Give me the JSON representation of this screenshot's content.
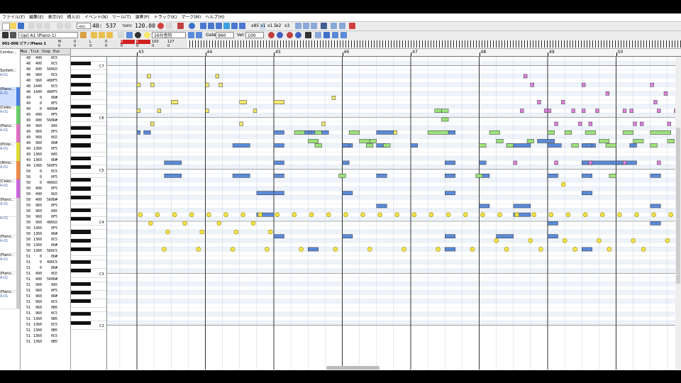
{
  "menu": [
    "ファイル(F)",
    "編集(E)",
    "表示(V)",
    "挿入(I)",
    "イベント(N)",
    "ツール(T)",
    "演奏(P)",
    "トラック(K)",
    "マーク(M)",
    "ヘルプ(H)"
  ],
  "toolbar": {
    "position": "40: 537",
    "tempo": "120.00",
    "track_select": "(gs) A1 (Piano 1)",
    "snap": "16分音符",
    "gate_label": "Gate:",
    "gate_value": "960",
    "vel_label": "Vel:",
    "vel_value": "100",
    "zoom_x85": "x85",
    "zoom_x1": "x1",
    "zoom_x15": "x1.5",
    "zoom_x2": "x2",
    "zoom_x3": "x3"
  },
  "track_header": "001-008 ピアノ/Piano 1",
  "meter_values": [
    "0",
    "0",
    "0",
    "0",
    "0",
    "0",
    "0",
    "0"
  ],
  "meter_labels": [
    "M",
    "0",
    "L",
    "0",
    "R",
    "1",
    "100",
    "127"
  ],
  "tracks": [
    {
      "name": "Conduc...",
      "sub": "",
      "color": "#ffffff"
    },
    {
      "name": "System...",
      "sub": "A-01",
      "color": "#ffffff"
    },
    {
      "name": "(Piano...",
      "sub": "A-01",
      "color": "#4a7fe0"
    },
    {
      "name": "(Celes...",
      "sub": "A-01",
      "color": "#66cc66"
    },
    {
      "name": "(Piano...",
      "sub": "A-01",
      "color": "#e070c0"
    },
    {
      "name": "(Picke...",
      "sub": "A-01",
      "color": "#dddd33"
    },
    {
      "name": "(Atmo...",
      "sub": "A-01",
      "color": "#ee8844"
    },
    {
      "name": "(Celes...",
      "sub": "A-01",
      "color": "#cc66dd"
    },
    {
      "name": "(Piano...",
      "sub": "A-01",
      "color": "#cccccc"
    },
    {
      "name": "",
      "sub": "A-01",
      "color": "#cccccc"
    },
    {
      "name": "(Piano...",
      "sub": "A-01",
      "color": "#cccccc"
    },
    {
      "name": "(Piano...",
      "sub": "A-01",
      "color": "#cccccc"
    },
    {
      "name": "(Piano...",
      "sub": "A-01",
      "color": "#cccccc"
    },
    {
      "name": "(Piano...",
      "sub": "A-01",
      "color": "#cccccc"
    }
  ],
  "event_headers": [
    "Mea",
    "Tick",
    "Step",
    "Eve"
  ],
  "events": [
    [
      "48",
      "400",
      "0",
      "C5"
    ],
    [
      "48",
      "400",
      "0",
      "C5"
    ],
    [
      "48",
      "400",
      "560",
      "G5"
    ],
    [
      "48",
      "960",
      "0",
      "C5"
    ],
    [
      "48",
      "960",
      "480",
      "F5"
    ],
    [
      "48",
      "1440",
      "0",
      "C5"
    ],
    [
      "48",
      "1440",
      "480",
      "F5"
    ],
    [
      "49",
      "0",
      "0",
      "D#"
    ],
    [
      "49",
      "0",
      "0",
      "F5"
    ],
    [
      "49",
      "0",
      "480",
      "D#"
    ],
    [
      "49",
      "400",
      "0",
      "F5"
    ],
    [
      "49",
      "400",
      "560",
      "D#"
    ],
    [
      "49",
      "960",
      "0",
      "A5"
    ],
    [
      "49",
      "960",
      "0",
      "F5"
    ],
    [
      "49",
      "960",
      "0",
      "G5"
    ],
    [
      "49",
      "960",
      "0",
      "D#"
    ],
    [
      "49",
      "1360",
      "0",
      "F5"
    ],
    [
      "49",
      "1360",
      "0",
      "A5"
    ],
    [
      "49",
      "1360",
      "0",
      "D#"
    ],
    [
      "49",
      "1360",
      "560",
      "F5"
    ],
    [
      "50",
      "0",
      "0",
      "C5"
    ],
    [
      "50",
      "0",
      "0",
      "F5"
    ],
    [
      "50",
      "0",
      "400",
      "G5"
    ],
    [
      "50",
      "400",
      "0",
      "F5"
    ],
    [
      "50",
      "400",
      "0",
      "G5"
    ],
    [
      "50",
      "400",
      "560",
      "D#"
    ],
    [
      "50",
      "960",
      "0",
      "F5"
    ],
    [
      "50",
      "960",
      "0",
      "A5"
    ],
    [
      "50",
      "960",
      "0",
      "F5"
    ],
    [
      "50",
      "960",
      "480",
      "G5"
    ],
    [
      "50",
      "1360",
      "0",
      "F5"
    ],
    [
      "50",
      "1360",
      "0",
      "D#"
    ],
    [
      "50",
      "1360",
      "0",
      "C5"
    ],
    [
      "50",
      "1360",
      "0",
      "D#"
    ],
    [
      "50",
      "1360",
      "560",
      "C5"
    ],
    [
      "51",
      "0",
      "0",
      "D#"
    ],
    [
      "51",
      "0",
      "400",
      "C5"
    ],
    [
      "51",
      "0",
      "0",
      "D#"
    ],
    [
      "51",
      "400",
      "0",
      "G5"
    ],
    [
      "51",
      "400",
      "560",
      "D#"
    ],
    [
      "51",
      "960",
      "0",
      "A5"
    ],
    [
      "51",
      "960",
      "0",
      "F5"
    ],
    [
      "51",
      "960",
      "0",
      "D#"
    ],
    [
      "51",
      "960",
      "0",
      "C5"
    ],
    [
      "51",
      "960",
      "0",
      "B5"
    ],
    [
      "51",
      "960",
      "0",
      "C5"
    ],
    [
      "51",
      "1360",
      "0",
      "B5"
    ],
    [
      "51",
      "1360",
      "0",
      "C5"
    ],
    [
      "51",
      "1360",
      "0",
      "B5"
    ],
    [
      "51",
      "1360",
      "0",
      "C5"
    ],
    [
      "51",
      "1360",
      "0",
      "B5"
    ]
  ],
  "bars": [
    "43",
    "44",
    "45",
    "46",
    "47",
    "48",
    "49",
    "50"
  ],
  "octaves": [
    "C7",
    "C6",
    "C5",
    "C4",
    "C3",
    "C2"
  ],
  "colors": {
    "blue_note": "#5b8ad8",
    "green_note": "#9ee27a",
    "pink_note": "#e282de",
    "yellow_note": "#f5ea6a",
    "yellow_dot": "#f2e34a",
    "grid_line": "#dbe3ee",
    "bar_line": "#333333"
  },
  "notes": {
    "blue": [
      [
        49.5,
        0.8,
        38
      ],
      [
        43.1,
        0.1,
        45
      ],
      [
        43.4,
        0.25,
        35
      ],
      [
        44.75,
        0.25,
        26
      ],
      [
        45.35,
        0.25,
        45
      ],
      [
        45.0,
        0.15,
        45
      ],
      [
        45.5,
        0.05,
        45
      ],
      [
        45.7,
        0.1,
        45
      ],
      [
        46.5,
        0.25,
        45
      ],
      [
        47.5,
        0.15,
        45
      ],
      [
        46.0,
        0.15,
        42
      ],
      [
        47.0,
        0.1,
        42
      ],
      [
        48.4,
        0.1,
        42
      ],
      [
        48.85,
        0.25,
        43
      ],
      [
        49.55,
        0.15,
        42
      ],
      [
        50.2,
        0.1,
        42
      ],
      [
        43.0,
        0.05,
        45
      ],
      [
        44.4,
        0.25,
        42
      ],
      [
        45.0,
        0.15,
        42
      ],
      [
        46.0,
        0.1,
        42
      ],
      [
        46.5,
        0.15,
        42
      ],
      [
        48.5,
        0.25,
        42
      ],
      [
        49.0,
        0.2,
        42
      ],
      [
        49.5,
        0.15,
        42
      ],
      [
        45.0,
        0.15,
        38
      ],
      [
        46.0,
        0.1,
        38
      ],
      [
        47.5,
        0.15,
        38
      ],
      [
        48.0,
        0.1,
        38
      ],
      [
        49.5,
        0.15,
        38
      ],
      [
        50.0,
        0.1,
        38
      ],
      [
        43.4,
        0.25,
        38
      ],
      [
        44.4,
        0.25,
        35
      ],
      [
        45.0,
        0.15,
        35
      ],
      [
        46.5,
        0.15,
        35
      ],
      [
        47.5,
        0.15,
        35
      ],
      [
        48.0,
        0.15,
        35
      ],
      [
        49.0,
        0.15,
        35
      ],
      [
        49.5,
        0.15,
        35
      ],
      [
        50.5,
        0.15,
        35
      ],
      [
        44.75,
        0.25,
        31
      ],
      [
        45.0,
        0.15,
        31
      ],
      [
        46.0,
        0.15,
        31
      ],
      [
        46.5,
        0.15,
        28
      ],
      [
        47.5,
        0.15,
        31
      ],
      [
        48.0,
        0.15,
        28
      ],
      [
        48.5,
        0.25,
        28
      ],
      [
        49.5,
        0.15,
        31
      ],
      [
        50.5,
        0.15,
        28
      ],
      [
        49.0,
        0.15,
        24
      ],
      [
        50.5,
        0.15,
        24
      ],
      [
        45.0,
        0.15,
        21
      ],
      [
        46.0,
        0.15,
        21
      ],
      [
        47.5,
        0.15,
        21
      ],
      [
        48.25,
        0.25,
        21
      ],
      [
        49.0,
        0.15,
        21
      ],
      [
        45.5,
        0.15,
        18
      ],
      [
        47.5,
        0.15,
        18
      ],
      [
        49.5,
        0.15,
        18
      ],
      [
        48.5,
        0.25,
        26
      ]
    ],
    "green": [
      [
        45.3,
        0.15,
        45
      ],
      [
        45.6,
        0.1,
        45
      ],
      [
        46.1,
        0.15,
        45
      ],
      [
        47.25,
        0.3,
        45
      ],
      [
        48.15,
        0.15,
        45
      ],
      [
        49.0,
        0.1,
        45
      ],
      [
        49.25,
        0.1,
        45
      ],
      [
        49.55,
        0.15,
        45
      ],
      [
        50.1,
        0.15,
        45
      ],
      [
        50.5,
        0.3,
        45
      ],
      [
        45.5,
        0.15,
        43
      ],
      [
        46.25,
        0.15,
        43
      ],
      [
        46.4,
        0.1,
        43
      ],
      [
        48.25,
        0.1,
        43
      ],
      [
        49.75,
        0.15,
        43
      ],
      [
        50.25,
        0.15,
        43
      ],
      [
        50.75,
        0.1,
        43
      ],
      [
        45.6,
        0.1,
        42
      ],
      [
        46.35,
        0.1,
        42
      ],
      [
        48.4,
        0.1,
        42
      ],
      [
        49.35,
        0.1,
        42
      ],
      [
        50.5,
        0.1,
        42
      ],
      [
        45.95,
        0.1,
        35
      ],
      [
        47.95,
        0.1,
        35
      ],
      [
        49.9,
        0.1,
        35
      ],
      [
        47.35,
        0.1,
        50
      ],
      [
        47.45,
        0.1,
        50
      ],
      [
        47.45,
        0.1,
        48
      ],
      [
        48.7,
        0.1,
        43
      ],
      [
        46.6,
        0.1,
        42
      ],
      [
        48.0,
        0.1,
        42
      ],
      [
        49.85,
        0.15,
        42
      ]
    ],
    "pink": [
      [
        48.65,
        0.05,
        58
      ],
      [
        48.75,
        0.05,
        56
      ],
      [
        49.5,
        0.05,
        56
      ],
      [
        50.5,
        0.05,
        56
      ],
      [
        49.85,
        0.05,
        54
      ],
      [
        50.7,
        0.05,
        54
      ],
      [
        48.85,
        0.05,
        52
      ],
      [
        49.2,
        0.05,
        52
      ],
      [
        50.55,
        0.05,
        52
      ],
      [
        49.0,
        0.05,
        50
      ],
      [
        49.5,
        0.05,
        50
      ],
      [
        50.1,
        0.05,
        50
      ],
      [
        48.6,
        0.05,
        50
      ],
      [
        48.95,
        0.05,
        50
      ],
      [
        49.35,
        0.05,
        50
      ],
      [
        49.7,
        0.05,
        50
      ],
      [
        50.2,
        0.05,
        50
      ],
      [
        50.6,
        0.05,
        50
      ],
      [
        50.85,
        0.05,
        50
      ],
      [
        49.1,
        0.05,
        47
      ],
      [
        49.45,
        0.05,
        47
      ],
      [
        49.6,
        0.05,
        47
      ],
      [
        50.25,
        0.05,
        47
      ],
      [
        50.35,
        0.05,
        47
      ],
      [
        50.75,
        0.05,
        47
      ],
      [
        50.9,
        0.05,
        47
      ],
      [
        48.5,
        0.05,
        38
      ],
      [
        49.1,
        0.05,
        38
      ],
      [
        49.6,
        0.05,
        38
      ],
      [
        50.1,
        0.05,
        38
      ],
      [
        50.6,
        0.05,
        38
      ]
    ],
    "yellow": [
      [
        43.15,
        0.05,
        58
      ],
      [
        44.15,
        0.05,
        58
      ],
      [
        43.0,
        0.05,
        56
      ],
      [
        43.2,
        0.05,
        56
      ],
      [
        44.0,
        0.05,
        56
      ],
      [
        44.2,
        0.05,
        56
      ],
      [
        45.85,
        0.05,
        53
      ],
      [
        43.0,
        0.05,
        50
      ],
      [
        43.3,
        0.05,
        50
      ],
      [
        43.5,
        0.1,
        52
      ],
      [
        44.0,
        0.05,
        50
      ],
      [
        44.5,
        0.1,
        52
      ],
      [
        44.7,
        0.05,
        50
      ],
      [
        45.0,
        0.15,
        52
      ],
      [
        43.2,
        0.05,
        47
      ],
      [
        44.5,
        0.05,
        47
      ],
      [
        45.7,
        0.05,
        47
      ],
      [
        46.75,
        0.05,
        45
      ]
    ],
    "yellow_dots": [
      [
        43.05,
        26
      ],
      [
        43.3,
        26
      ],
      [
        43.55,
        26
      ],
      [
        43.8,
        26
      ],
      [
        44.05,
        26
      ],
      [
        44.3,
        26
      ],
      [
        44.55,
        26
      ],
      [
        44.8,
        26
      ],
      [
        45.05,
        26
      ],
      [
        45.3,
        26
      ],
      [
        45.55,
        26
      ],
      [
        45.8,
        26
      ],
      [
        46.05,
        26
      ],
      [
        46.3,
        26
      ],
      [
        46.55,
        26
      ],
      [
        46.8,
        26
      ],
      [
        47.05,
        26
      ],
      [
        47.3,
        26
      ],
      [
        47.55,
        26
      ],
      [
        47.8,
        26
      ],
      [
        48.05,
        26
      ],
      [
        48.3,
        26
      ],
      [
        48.55,
        26
      ],
      [
        48.8,
        26
      ],
      [
        49.05,
        26
      ],
      [
        49.3,
        26
      ],
      [
        49.55,
        26
      ],
      [
        49.8,
        26
      ],
      [
        50.05,
        26
      ],
      [
        50.3,
        26
      ],
      [
        50.55,
        26
      ],
      [
        50.8,
        26
      ],
      [
        43.2,
        24
      ],
      [
        43.7,
        24
      ],
      [
        44.2,
        24
      ],
      [
        44.7,
        24
      ],
      [
        43.45,
        22
      ],
      [
        43.95,
        22
      ],
      [
        44.45,
        22
      ],
      [
        44.95,
        22
      ],
      [
        48.25,
        20
      ],
      [
        48.75,
        20
      ],
      [
        49.25,
        20
      ],
      [
        49.75,
        20
      ],
      [
        50.25,
        20
      ],
      [
        50.75,
        20
      ],
      [
        43.4,
        18
      ],
      [
        43.9,
        18
      ],
      [
        44.4,
        18
      ],
      [
        44.9,
        18
      ],
      [
        45.4,
        18
      ],
      [
        45.9,
        18
      ],
      [
        46.4,
        18
      ],
      [
        46.9,
        18
      ],
      [
        47.4,
        18
      ],
      [
        47.9,
        18
      ],
      [
        48.4,
        18
      ],
      [
        48.9,
        18
      ],
      [
        49.4,
        18
      ],
      [
        49.9,
        18
      ],
      [
        50.4,
        18
      ],
      [
        50.9,
        18
      ],
      [
        49.23,
        33
      ]
    ]
  }
}
